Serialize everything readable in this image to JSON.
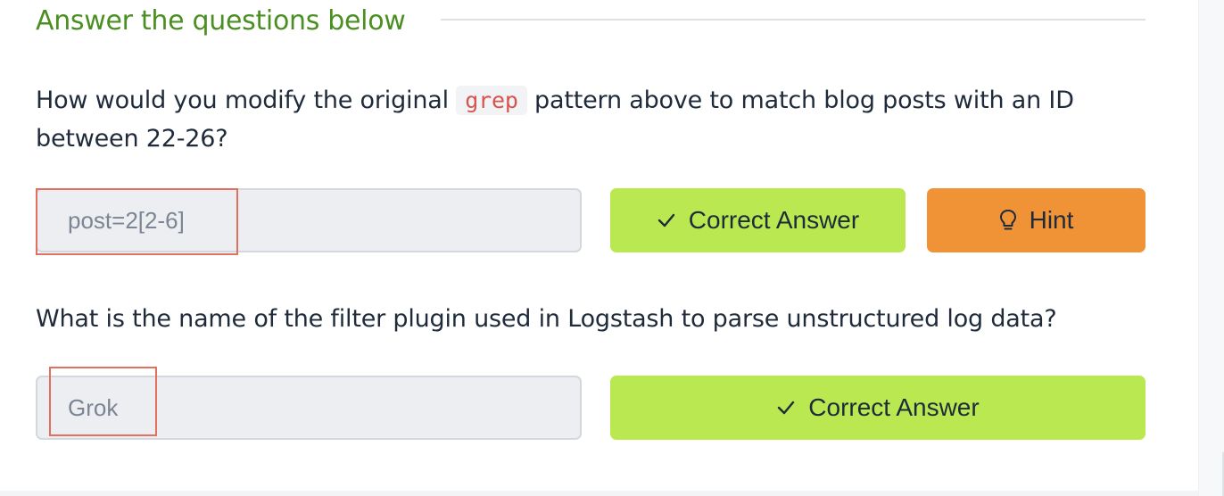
{
  "section": {
    "title": "Answer the questions below"
  },
  "questions": [
    {
      "text_before": "How would you modify the original ",
      "code": "grep",
      "text_after": " pattern above to match blog posts with an ID between 22-26?",
      "answer_value": "post=2[2-6]",
      "submit_label": "Correct Answer",
      "hint_label": "Hint"
    },
    {
      "text": "What is the name of the filter plugin used in Logstash to parse unstructured log data?",
      "answer_value": "Grok",
      "submit_label": "Correct Answer"
    }
  ],
  "colors": {
    "section_title": "#4b8f22",
    "correct_button": "#b9e851",
    "hint_button": "#f09236",
    "code_text": "#d9534f",
    "annotation_box": "#e2705f"
  },
  "icons": {
    "correct": "check-icon",
    "hint": "lightbulb-icon"
  }
}
